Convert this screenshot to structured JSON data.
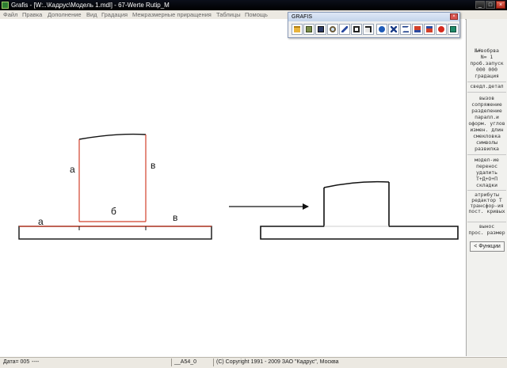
{
  "window": {
    "title": "Grafis - [W:..\\Кадрус\\Модель 1.mdl] - 67-Werte Rutip_M",
    "buttons": [
      "_",
      "□",
      "×"
    ]
  },
  "menu": {
    "items": [
      "Файл",
      "Правка",
      "Дополнение",
      "Вид",
      "Градация",
      "Межразмерные приращения",
      "Таблицы",
      "Помощь"
    ]
  },
  "toolbar": {
    "title": "GRAFIS",
    "icons": [
      "open-folder-icon",
      "save-as-icon",
      "save-icon",
      "zoom-icon",
      "pen-icon",
      "frame-icon",
      "layers-icon",
      "transform-icon",
      "dimension-icon",
      "cut-icon",
      "export-icon",
      "import-icon",
      "stop-icon",
      "monitor-icon"
    ]
  },
  "right_panel": {
    "group1": [
      "№#вобрва",
      "N=  1",
      "проб.запуск",
      "000 000",
      "градация"
    ],
    "group2": [
      "сведл.детал"
    ],
    "group3": [
      "вызов",
      "сопряжение",
      "разделение",
      "паралл.и",
      "оформ. углов",
      "измен. длин",
      "смекловка",
      "символы",
      "развилка"
    ],
    "group4": [
      "модел-ие",
      "перенос",
      "удалить",
      "Т+Д+О+П",
      "складки"
    ],
    "group5": [
      "атрибуты",
      "редактор Т",
      "трансфор-ия",
      "пост. кривых"
    ],
    "group6": [
      "вынос",
      "прос. размер"
    ],
    "functions_button": "< Функции"
  },
  "drawing": {
    "labels_left_piece": [
      "а",
      "в"
    ],
    "labels_strip": [
      "а",
      "б",
      "в"
    ],
    "colors": {
      "outline": "#111111",
      "highlight": "#d2402a"
    }
  },
  "status": {
    "date": "Дата= 005",
    "dashes": "----",
    "code": "__A54_0",
    "copyright": "(C) Copyright 1991 - 2009 ЗАО \"Кадрус\", Москва"
  }
}
